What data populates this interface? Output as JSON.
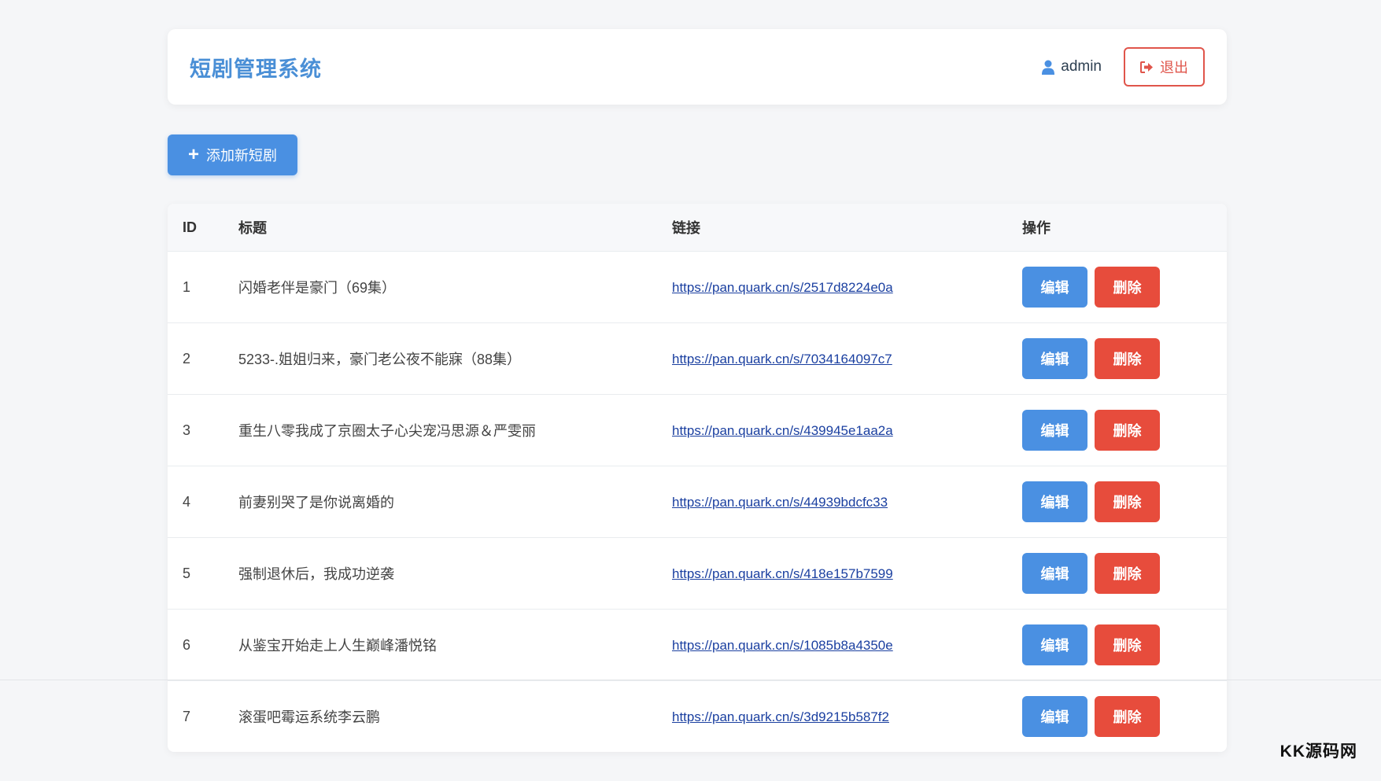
{
  "header": {
    "title": "短剧管理系统",
    "username": "admin",
    "logout_label": "退出"
  },
  "toolbar": {
    "add_label": "添加新短剧"
  },
  "table": {
    "columns": [
      "ID",
      "标题",
      "链接",
      "操作"
    ],
    "edit_label": "编辑",
    "delete_label": "删除",
    "rows": [
      {
        "id": "1",
        "title": "闪婚老伴是豪门（69集）",
        "link": "https://pan.quark.cn/s/2517d8224e0a"
      },
      {
        "id": "2",
        "title": "5233-.姐姐归来，豪门老公夜不能寐（88集）",
        "link": "https://pan.quark.cn/s/7034164097c7"
      },
      {
        "id": "3",
        "title": "重生八零我成了京圈太子心尖宠冯思源＆严雯丽",
        "link": "https://pan.quark.cn/s/439945e1aa2a"
      },
      {
        "id": "4",
        "title": "前妻别哭了是你说离婚的",
        "link": "https://pan.quark.cn/s/44939bdcfc33"
      },
      {
        "id": "5",
        "title": "强制退休后，我成功逆袭",
        "link": "https://pan.quark.cn/s/418e157b7599"
      },
      {
        "id": "6",
        "title": "从鉴宝开始走上人生巅峰潘悦铭",
        "link": "https://pan.quark.cn/s/1085b8a4350e"
      },
      {
        "id": "7",
        "title": "滚蛋吧霉运系统李云鹏",
        "link": "https://pan.quark.cn/s/3d9215b587f2"
      }
    ]
  },
  "watermark": "KK源码网",
  "colors": {
    "primary": "#4a90e2",
    "danger": "#e74c3c",
    "title": "#4a8fd6",
    "link": "#1a3fa0"
  },
  "icons": {
    "user": "user-icon",
    "logout": "sign-out-icon",
    "add": "plus-icon"
  }
}
